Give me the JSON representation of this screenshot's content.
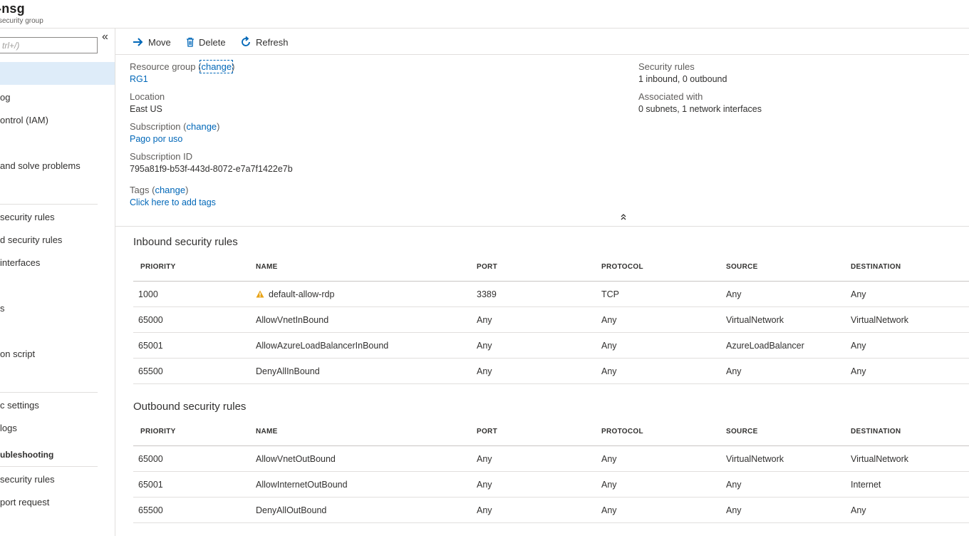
{
  "header": {
    "title": "-nsg",
    "subtitle": "security group"
  },
  "sidebar": {
    "search_placeholder": "trl+/)",
    "collapse_icon": "chevron-double-left-icon",
    "items": [
      {
        "label": "",
        "selected": true
      },
      {
        "label": "og"
      },
      {
        "label": "ontrol (IAM)"
      },
      {
        "label": ""
      },
      {
        "label": " and solve problems"
      },
      {
        "label": "security rules"
      },
      {
        "label": "d security rules"
      },
      {
        "label": "interfaces"
      },
      {
        "label": ""
      },
      {
        "label": "s"
      },
      {
        "label": ""
      },
      {
        "label": "on script"
      },
      {
        "label": "c settings"
      },
      {
        "label": " logs"
      },
      {
        "label": "ubleshooting"
      },
      {
        "label": "security rules"
      },
      {
        "label": "port request"
      }
    ]
  },
  "toolbar": {
    "move_label": "Move",
    "delete_label": "Delete",
    "refresh_label": "Refresh"
  },
  "essentials": {
    "resource_group_label": "Resource group",
    "resource_group_value": "RG1",
    "location_label": "Location",
    "location_value": "East US",
    "subscription_label": "Subscription",
    "subscription_value": "Pago por uso",
    "subscription_id_label": "Subscription ID",
    "subscription_id_value": "795a81f9-b53f-443d-8072-e7a7f1422e7b",
    "tags_label": "Tags",
    "tags_value": "Click here to add tags",
    "security_rules_label": "Security rules",
    "security_rules_value": "1 inbound, 0 outbound",
    "associated_label": "Associated with",
    "associated_value": "0 subnets, 1 network interfaces",
    "change_text": "change",
    "open_paren": "(",
    "close_paren": ")"
  },
  "columns": [
    "PRIORITY",
    "NAME",
    "PORT",
    "PROTOCOL",
    "SOURCE",
    "DESTINATION"
  ],
  "inbound": {
    "title": "Inbound security rules",
    "rows": [
      {
        "priority": "1000",
        "name": "default-allow-rdp",
        "port": "3389",
        "protocol": "TCP",
        "source": "Any",
        "destination": "Any",
        "warning": true
      },
      {
        "priority": "65000",
        "name": "AllowVnetInBound",
        "port": "Any",
        "protocol": "Any",
        "source": "VirtualNetwork",
        "destination": "VirtualNetwork"
      },
      {
        "priority": "65001",
        "name": "AllowAzureLoadBalancerInBound",
        "port": "Any",
        "protocol": "Any",
        "source": "AzureLoadBalancer",
        "destination": "Any"
      },
      {
        "priority": "65500",
        "name": "DenyAllInBound",
        "port": "Any",
        "protocol": "Any",
        "source": "Any",
        "destination": "Any"
      }
    ]
  },
  "outbound": {
    "title": "Outbound security rules",
    "rows": [
      {
        "priority": "65000",
        "name": "AllowVnetOutBound",
        "port": "Any",
        "protocol": "Any",
        "source": "VirtualNetwork",
        "destination": "VirtualNetwork"
      },
      {
        "priority": "65001",
        "name": "AllowInternetOutBound",
        "port": "Any",
        "protocol": "Any",
        "source": "Any",
        "destination": "Internet"
      },
      {
        "priority": "65500",
        "name": "DenyAllOutBound",
        "port": "Any",
        "protocol": "Any",
        "source": "Any",
        "destination": "Any"
      }
    ]
  },
  "colors": {
    "link": "#0067b8",
    "selected_bg": "#deecf9",
    "warning": "#e8a317"
  }
}
